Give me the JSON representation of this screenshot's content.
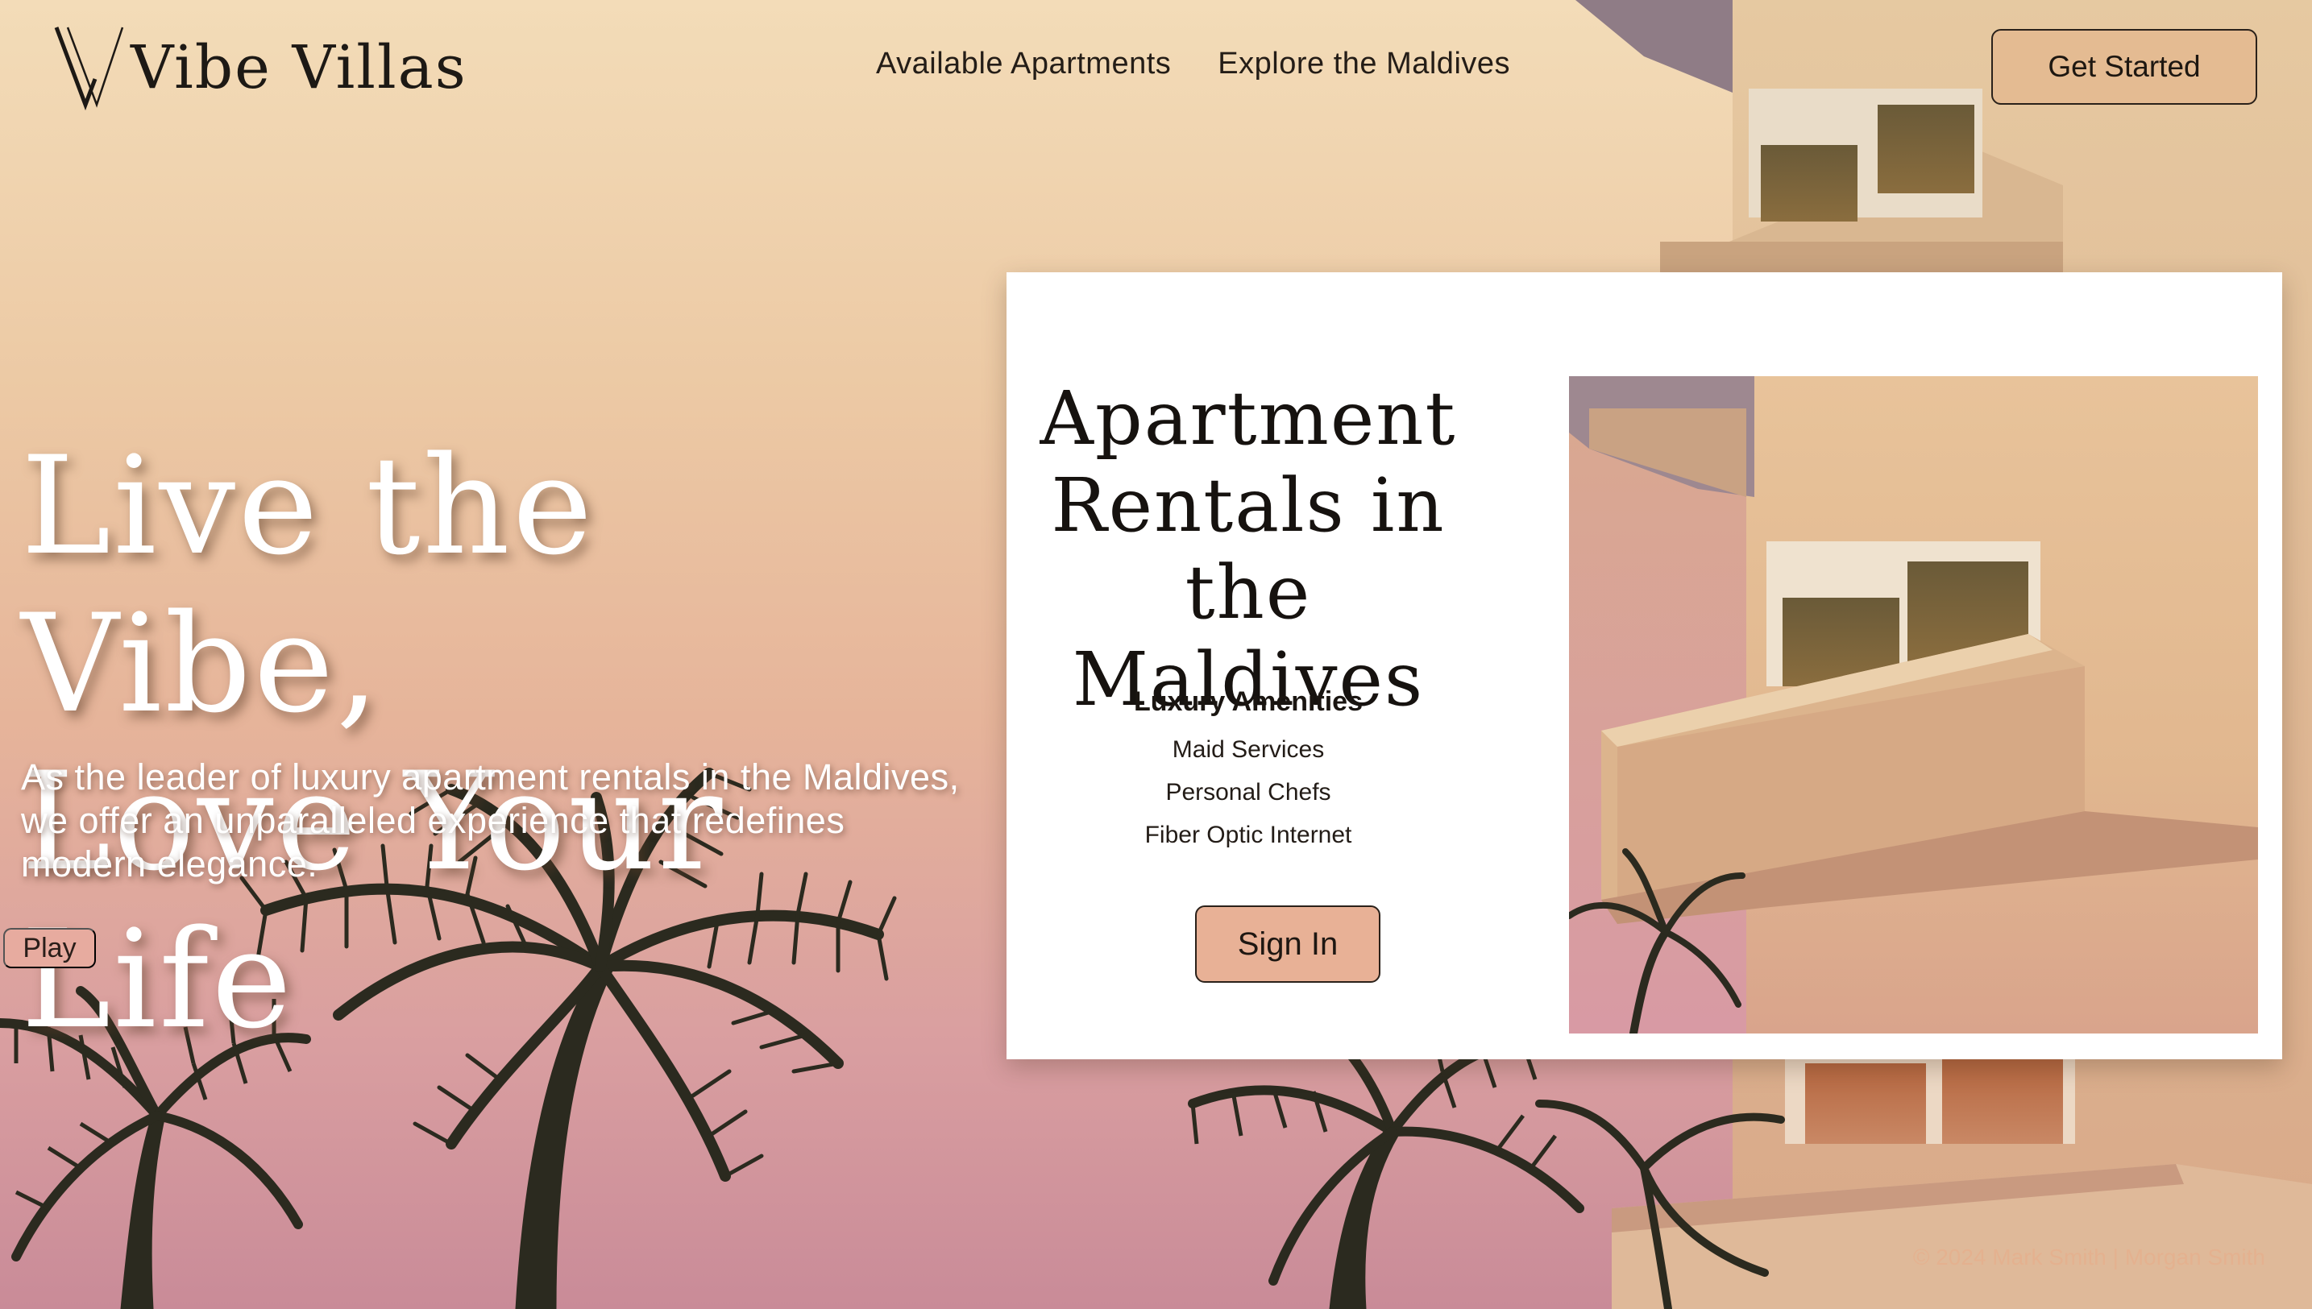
{
  "brand": {
    "name": "Vibe Villas",
    "logo_icon": "vw-monogram-icon"
  },
  "nav": {
    "items": [
      {
        "label": "Available Apartments"
      },
      {
        "label": "Explore the Maldives"
      }
    ],
    "cta_label": "Get Started"
  },
  "hero": {
    "title_line1": "Live the Vibe,",
    "title_line2": "Love Your Life",
    "subtitle": "As the leader of luxury apartment rentals in the Maldives, we offer an unparalleled experience that redefines modern elegance.",
    "play_label": "Play"
  },
  "card": {
    "title": "Apartment Rentals in the Maldives",
    "amenities_heading": "Luxury Amenities",
    "amenities": [
      "Maid Services",
      "Personal Chefs",
      "Fiber Optic Internet"
    ],
    "signin_label": "Sign In",
    "photo_alt": "apartment-building-photo"
  },
  "footer": {
    "text": "© 2024 Mark Smith | Morgan Smith"
  },
  "colors": {
    "sky_top": "#f3dcb8",
    "sky_bottom": "#c98b98",
    "building": "#e2bf96",
    "palm": "#2b2a1f",
    "cta_bg": "#e4bb92",
    "signin_bg": "#e8b196",
    "play_bg": "#e7ab9f"
  }
}
